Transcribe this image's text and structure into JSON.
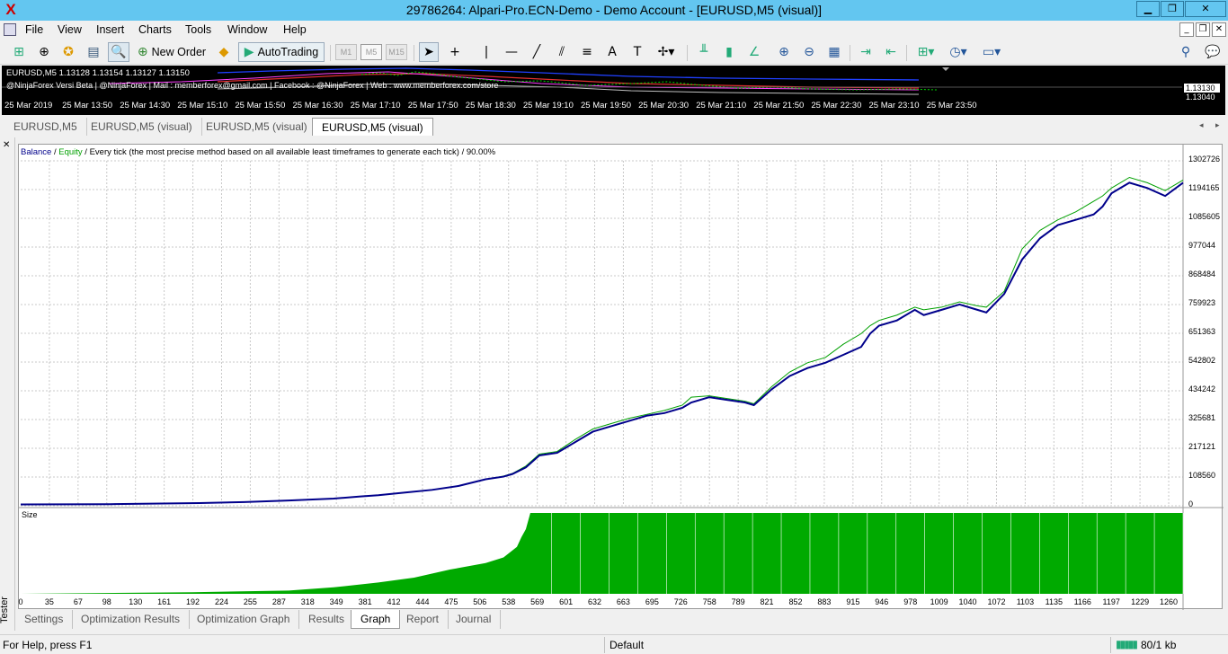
{
  "window": {
    "title": "29786264: Alpari-Pro.ECN-Demo - Demo Account - [EURUSD,M5 (visual)]",
    "minimize": "▁",
    "maximize": "❐",
    "close": "✕"
  },
  "menu": [
    "File",
    "View",
    "Insert",
    "Charts",
    "Tools",
    "Window",
    "Help"
  ],
  "toolbar": {
    "new_order": "New Order",
    "autotrading": "AutoTrading",
    "timeframes": [
      "M1",
      "M5",
      "M15"
    ]
  },
  "mini_chart": {
    "header": "EURUSD,M5  1.13128 1.13154 1.13127 1.13150",
    "contact": "@NinjaForex Versi Beta  | @NinjaForex | Mail : memberforex@gmail.com  | Facebook : @NinjaForex | Web : www.memberforex.com/store",
    "prices": [
      "1.13130",
      "1.13040"
    ],
    "times": [
      "25 Mar 2019",
      "25 Mar 13:50",
      "25 Mar 14:30",
      "25 Mar 15:10",
      "25 Mar 15:50",
      "25 Mar 16:30",
      "25 Mar 17:10",
      "25 Mar 17:50",
      "25 Mar 18:30",
      "25 Mar 19:10",
      "25 Mar 19:50",
      "25 Mar 20:30",
      "25 Mar 21:10",
      "25 Mar 21:50",
      "25 Mar 22:30",
      "25 Mar 23:10",
      "25 Mar 23:50"
    ]
  },
  "chart_tabs": [
    "EURUSD,M5",
    "EURUSD,M5 (visual)",
    "EURUSD,M5 (visual)",
    "EURUSD,M5 (visual)"
  ],
  "tester": {
    "label": "Tester",
    "close": "✕"
  },
  "legend": {
    "balance": "Balance",
    "sep1": " / ",
    "equity": "Equity",
    "rest": " / Every tick (the most precise method based on all available least timeframes to generate each tick) / 90.00%"
  },
  "size_label": "Size",
  "bottom_tabs": [
    "Settings",
    "Optimization Results",
    "Optimization Graph",
    "Results",
    "Graph",
    "Report",
    "Journal"
  ],
  "status": {
    "help": "For Help, press F1",
    "profile": "Default",
    "connection": "80/1 kb"
  },
  "colors": {
    "title_bar": "#63c6f0",
    "balance": "#00008b",
    "equity": "#00a000",
    "size_bars": "#00aa00"
  },
  "chart_data": {
    "type": "line",
    "ylim": [
      0,
      1302726
    ],
    "y_ticks": [
      "1302726",
      "1194165",
      "1085605",
      "977044",
      "868484",
      "759923",
      "651363",
      "542802",
      "434242",
      "325681",
      "217121",
      "108560",
      "0"
    ],
    "x_ticks": [
      "0",
      "35",
      "67",
      "98",
      "130",
      "161",
      "192",
      "224",
      "255",
      "287",
      "318",
      "349",
      "381",
      "412",
      "444",
      "475",
      "506",
      "538",
      "569",
      "601",
      "632",
      "663",
      "695",
      "726",
      "758",
      "789",
      "821",
      "852",
      "883",
      "915",
      "946",
      "978",
      "1009",
      "1040",
      "1072",
      "1103",
      "1135",
      "1166",
      "1197",
      "1229",
      "1260"
    ],
    "xlim": [
      0,
      1300
    ],
    "series": [
      {
        "name": "Balance",
        "x": [
          0,
          100,
          200,
          250,
          300,
          350,
          380,
          400,
          430,
          460,
          490,
          520,
          540,
          550,
          565,
          580,
          600,
          620,
          640,
          660,
          680,
          700,
          720,
          740,
          750,
          770,
          790,
          810,
          820,
          840,
          860,
          880,
          900,
          920,
          940,
          950,
          960,
          980,
          1000,
          1010,
          1030,
          1050,
          1070,
          1080,
          1100,
          1120,
          1140,
          1160,
          1180,
          1200,
          1210,
          1220,
          1240,
          1260,
          1280,
          1300
        ],
        "y": [
          5000,
          6000,
          10000,
          14000,
          20000,
          27000,
          35000,
          40000,
          50000,
          60000,
          75000,
          100000,
          110000,
          120000,
          145000,
          190000,
          200000,
          240000,
          280000,
          300000,
          320000,
          340000,
          350000,
          370000,
          390000,
          410000,
          400000,
          390000,
          380000,
          440000,
          490000,
          520000,
          540000,
          570000,
          600000,
          650000,
          680000,
          700000,
          740000,
          720000,
          740000,
          760000,
          740000,
          730000,
          800000,
          930000,
          1010000,
          1060000,
          1080000,
          1100000,
          1130000,
          1180000,
          1220000,
          1200000,
          1170000,
          1220000
        ]
      },
      {
        "name": "Equity",
        "x": [
          0,
          100,
          200,
          250,
          300,
          350,
          380,
          400,
          430,
          460,
          490,
          520,
          540,
          550,
          565,
          580,
          600,
          620,
          640,
          660,
          680,
          700,
          720,
          740,
          750,
          770,
          790,
          810,
          820,
          840,
          860,
          880,
          900,
          920,
          940,
          950,
          960,
          980,
          1000,
          1010,
          1030,
          1050,
          1070,
          1080,
          1100,
          1120,
          1140,
          1160,
          1180,
          1200,
          1210,
          1220,
          1240,
          1260,
          1280,
          1300
        ],
        "y": [
          5000,
          6000,
          10000,
          14000,
          20000,
          27000,
          35000,
          40000,
          50000,
          60000,
          75000,
          100000,
          112000,
          122000,
          150000,
          195000,
          205000,
          250000,
          290000,
          310000,
          330000,
          345000,
          360000,
          380000,
          410000,
          415000,
          405000,
          395000,
          385000,
          450000,
          505000,
          540000,
          560000,
          610000,
          650000,
          680000,
          700000,
          720000,
          750000,
          740000,
          750000,
          770000,
          755000,
          750000,
          810000,
          970000,
          1040000,
          1080000,
          1110000,
          1150000,
          1170000,
          1200000,
          1240000,
          1220000,
          1190000,
          1230000
        ]
      }
    ],
    "size": {
      "x": [
        0,
        192,
        300,
        350,
        400,
        440,
        480,
        520,
        540,
        555,
        560,
        565,
        570,
        1300
      ],
      "y": [
        0,
        2,
        4,
        8,
        14,
        20,
        30,
        38,
        45,
        58,
        70,
        80,
        100,
        100
      ],
      "ylim": [
        0,
        100
      ]
    }
  }
}
